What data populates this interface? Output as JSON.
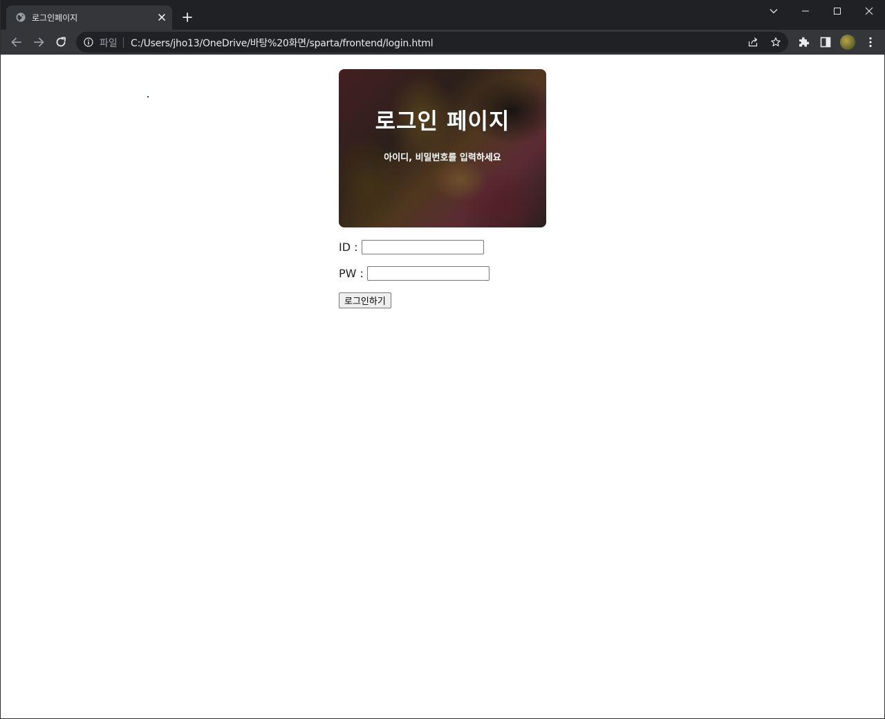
{
  "browser": {
    "tab": {
      "title": "로그인페이지",
      "favicon": "globe-icon",
      "close_icon": "close-icon"
    },
    "new_tab_icon": "plus-icon",
    "caption_buttons": [
      "chevron-down-icon",
      "minimize-icon",
      "maximize-icon",
      "close-icon"
    ],
    "toolbar": {
      "back_icon": "arrow-left-icon",
      "forward_icon": "arrow-right-icon",
      "reload_icon": "reload-icon",
      "omnibox": {
        "info_icon": "info-icon",
        "scheme_label": "파일",
        "url": "C:/Users/jho13/OneDrive/바탕%20화면/sparta/frontend/login.html",
        "share_icon": "share-icon",
        "bookmark_icon": "star-icon"
      },
      "extensions_icon": "puzzle-icon",
      "side_panel_icon": "side-panel-icon",
      "menu_icon": "kebab-menu-icon"
    },
    "colors": {
      "frame": "#202124",
      "toolbar": "#35363a",
      "text": "#e8eaed"
    }
  },
  "page": {
    "hero": {
      "title": "로그인 페이지",
      "subtitle": "아이디, 비밀번호를 입력하세요"
    },
    "form": {
      "id_label": "ID :",
      "id_value": "",
      "pw_label": "PW :",
      "pw_value": "",
      "submit_label": "로그인하기"
    }
  }
}
